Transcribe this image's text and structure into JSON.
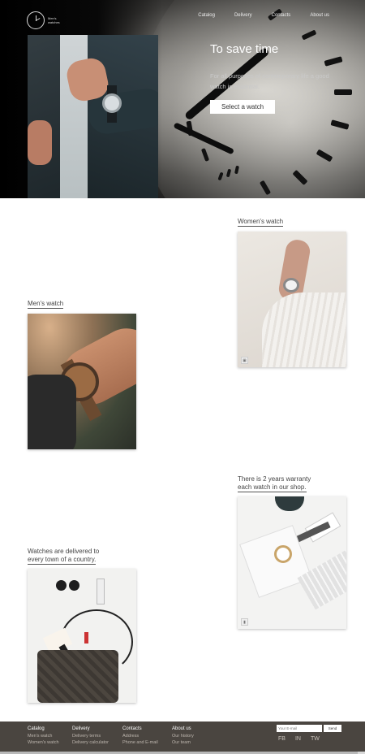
{
  "brand": {
    "name": "Men's watches"
  },
  "nav": [
    "Catalog",
    "Delivery",
    "Contacts",
    "About us"
  ],
  "hero": {
    "title": "To save time",
    "text": "For all purposes of contemporary life a good watch is essential.",
    "button": "Select a watch"
  },
  "sections": {
    "women": "Women's watch",
    "men": "Men's watch",
    "warranty_line1": "There is 2 years warranty",
    "warranty_line2": "each watch in our shop.",
    "delivery_line1": "Watches are delivered to",
    "delivery_line2": "every town of a country."
  },
  "footer": {
    "columns": [
      {
        "title": "Catalog",
        "links": [
          "Men's watch",
          "Women's watch"
        ]
      },
      {
        "title": "Delivery",
        "links": [
          "Delivery terms",
          "Delivery calculator"
        ]
      },
      {
        "title": "Contacts",
        "links": [
          "Address",
          "Phone and E-mail"
        ]
      },
      {
        "title": "About us",
        "links": [
          "Our history",
          "Our team"
        ]
      }
    ],
    "email_placeholder": "Your E-mail",
    "send": "Send",
    "social": [
      "FB",
      "IN",
      "TW"
    ]
  }
}
